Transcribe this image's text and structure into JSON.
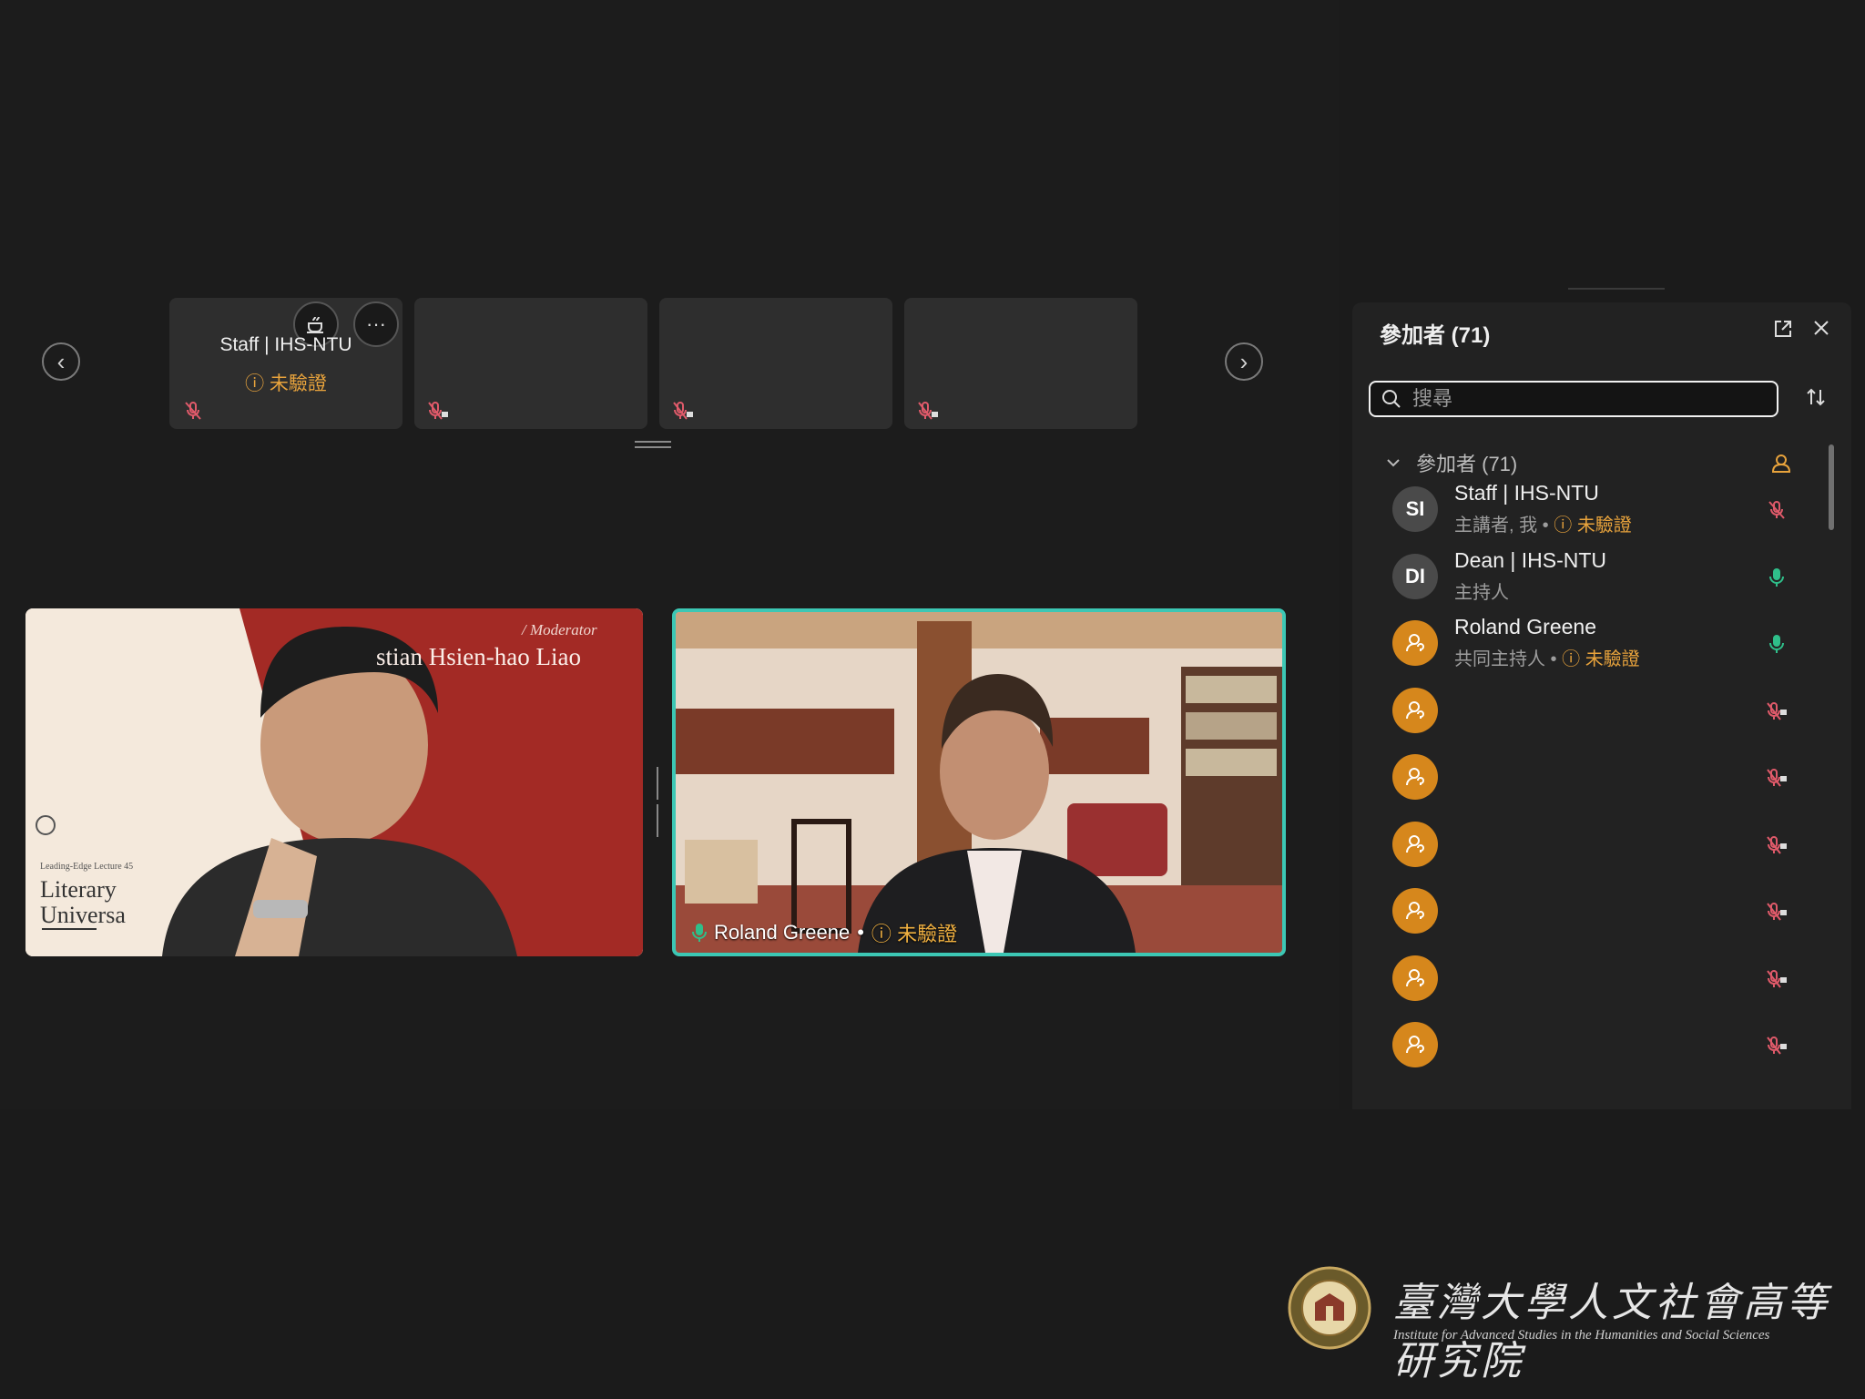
{
  "filmstrip": {
    "prev_label": "‹",
    "next_label": "›",
    "tiles": [
      {
        "name": "Staff | IHS-NTU",
        "status": "未驗證",
        "mic": "muted"
      },
      {
        "name": "",
        "status": "",
        "mic": "muted-locked"
      },
      {
        "name": "",
        "status": "",
        "mic": "muted-locked"
      },
      {
        "name": "",
        "status": "",
        "mic": "muted-locked"
      }
    ],
    "tile_ctrl_more": "···"
  },
  "video_left": {
    "slide_role": "/ Moderator",
    "slide_name": "stian Hsien-hao Liao",
    "slide_series": "Leading-Edge Lecture 45",
    "slide_title_1": "Literary",
    "slide_title_2": "Universa"
  },
  "video_right": {
    "name": "Roland Greene",
    "status": "未驗證",
    "border_color": "#3cc7b4"
  },
  "participants_panel": {
    "title": "參加者 (71)",
    "search_placeholder": "搜尋",
    "section_label": "參加者 (71)",
    "participants": [
      {
        "initials": "SI",
        "name": "Staff | IHS-NTU",
        "role": "主講者, 我",
        "status": "未驗證",
        "mic": "muted",
        "avatar": "gray"
      },
      {
        "initials": "DI",
        "name": "Dean | IHS-NTU",
        "role": "主持人",
        "status": "",
        "mic": "on",
        "avatar": "gray"
      },
      {
        "initials": "",
        "name": "Roland Greene",
        "role": "共同主持人",
        "status": "未驗證",
        "mic": "on",
        "avatar": "orange"
      },
      {
        "initials": "",
        "name": "",
        "role": "",
        "status": "",
        "mic": "muted-locked",
        "avatar": "orange"
      },
      {
        "initials": "",
        "name": "",
        "role": "",
        "status": "",
        "mic": "muted-locked",
        "avatar": "orange"
      },
      {
        "initials": "",
        "name": "",
        "role": "",
        "status": "",
        "mic": "muted-locked",
        "avatar": "orange"
      },
      {
        "initials": "",
        "name": "",
        "role": "",
        "status": "",
        "mic": "muted-locked",
        "avatar": "orange"
      },
      {
        "initials": "",
        "name": "",
        "role": "",
        "status": "",
        "mic": "muted-locked",
        "avatar": "orange"
      },
      {
        "initials": "",
        "name": "",
        "role": "",
        "status": "",
        "mic": "muted-locked",
        "avatar": "orange"
      }
    ]
  },
  "watermark": {
    "chinese": "臺灣大學人文社會高等研究院",
    "english": "Institute for Advanced Studies in the Humanities and Social Sciences"
  },
  "colors": {
    "warning": "#e8a33c",
    "mic_on": "#2fbf8a",
    "mic_off": "#e05a6a",
    "avatar_orange": "#d6871c",
    "active_speaker": "#3cc7b4"
  }
}
